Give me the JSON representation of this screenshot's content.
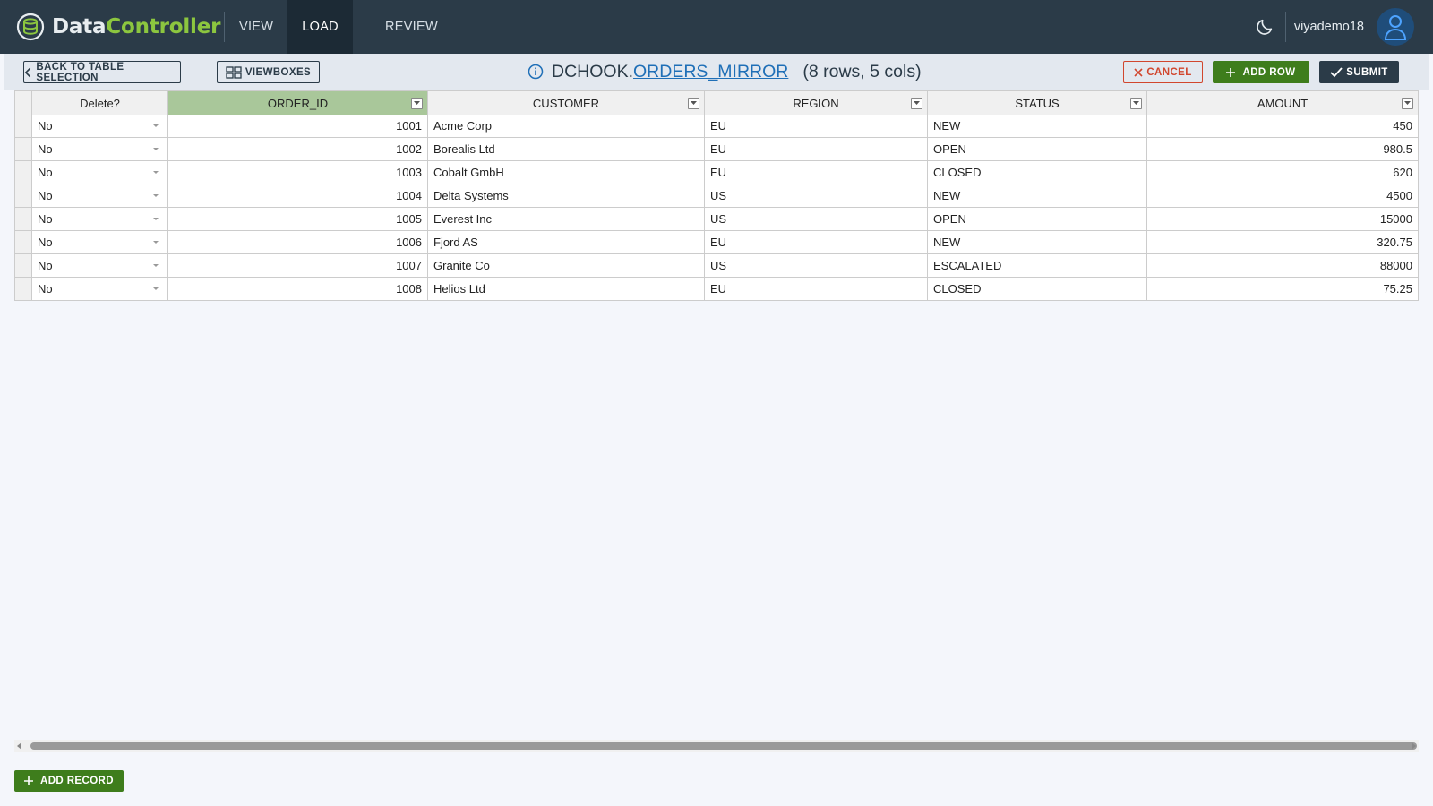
{
  "app": {
    "brand_part1": "Data",
    "brand_part2": "Controller"
  },
  "nav": {
    "view": "VIEW",
    "load": "LOAD",
    "review": "REVIEW"
  },
  "user": {
    "name": "viyademo18"
  },
  "toolbar": {
    "back_label": "BACK TO TABLE SELECTION",
    "viewboxes_label": "VIEWBOXES",
    "cancel_label": "CANCEL",
    "addrow_label": "ADD ROW",
    "submit_label": "SUBMIT",
    "title_lib": "DCHOOK.",
    "title_table": "ORDERS_MIRROR",
    "title_meta": "(8 rows, 5 cols)"
  },
  "table": {
    "columns": [
      "Delete?",
      "ORDER_ID",
      "CUSTOMER",
      "REGION",
      "STATUS",
      "AMOUNT"
    ],
    "rows": [
      {
        "delete": "No",
        "order_id": "1001",
        "customer": "Acme Corp",
        "region": "EU",
        "status": "NEW",
        "amount": "450"
      },
      {
        "delete": "No",
        "order_id": "1002",
        "customer": "Borealis Ltd",
        "region": "EU",
        "status": "OPEN",
        "amount": "980.5"
      },
      {
        "delete": "No",
        "order_id": "1003",
        "customer": "Cobalt GmbH",
        "region": "EU",
        "status": "CLOSED",
        "amount": "620"
      },
      {
        "delete": "No",
        "order_id": "1004",
        "customer": "Delta Systems",
        "region": "US",
        "status": "NEW",
        "amount": "4500"
      },
      {
        "delete": "No",
        "order_id": "1005",
        "customer": "Everest Inc",
        "region": "US",
        "status": "OPEN",
        "amount": "15000"
      },
      {
        "delete": "No",
        "order_id": "1006",
        "customer": "Fjord AS",
        "region": "EU",
        "status": "NEW",
        "amount": "320.75"
      },
      {
        "delete": "No",
        "order_id": "1007",
        "customer": "Granite Co",
        "region": "US",
        "status": "ESCALATED",
        "amount": "88000"
      },
      {
        "delete": "No",
        "order_id": "1008",
        "customer": "Helios Ltd",
        "region": "EU",
        "status": "CLOSED",
        "amount": "75.25"
      }
    ]
  },
  "footer": {
    "add_record_label": "ADD RECORD"
  },
  "colors": {
    "header_bg": "#2b3b48",
    "accent_green": "#3e7d1c",
    "cancel_red": "#d1462e",
    "link_blue": "#1f6fb7",
    "active_column": "#a9c79a"
  }
}
